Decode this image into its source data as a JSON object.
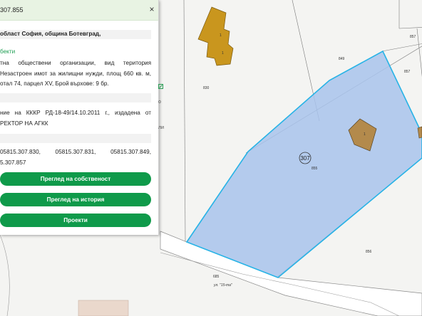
{
  "map": {
    "polygon_number": "307",
    "labels": {
      "p857a": "857",
      "p849": "849",
      "p857b": "857",
      "p830": "830",
      "p855": "855",
      "p856": "856",
      "p685": "685",
      "street": "ул. \"15-та\"",
      "b1a": "1",
      "b1b": "1",
      "b1c": "1"
    },
    "colors": {
      "selected_fill": "#a8c3ec",
      "selected_stroke": "#27b3e6",
      "building_fill": "#c9961e",
      "building_small_fill": "#b38a4c"
    }
  },
  "panel": {
    "title": "307.855",
    "close_label": "×",
    "address": "област София, община Ботевград,",
    "objects_link": "бекти",
    "description": "тна обществени организации, вид територия Незастроен имот за жилищни нужди, площ 660 кв. м, отал 74, парцел XV, Брой върхове: 9 бр.",
    "order": "ние на КККР РД-18-49/14.10.2011 г., издадена от РЕКТОР НА АГКК",
    "neighbors": "05815.307.830, 05815.307.831, 05815.307.849, 5.307.857",
    "buttons": {
      "ownership": "Преглед на собственост",
      "history": "Преглед на история",
      "projects": "Проекти"
    },
    "side_tools": [
      "о",
      "ли"
    ]
  }
}
